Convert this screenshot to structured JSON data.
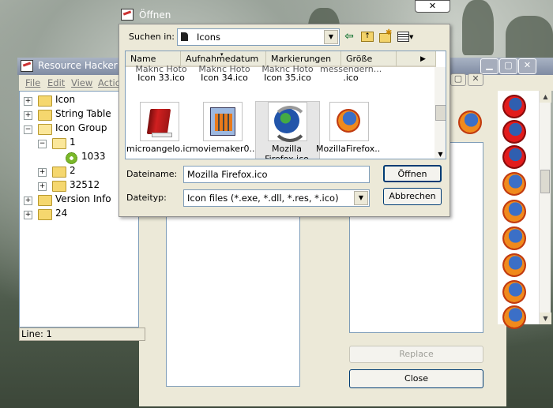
{
  "resource_hacker": {
    "title": "Resource Hacker - G",
    "menu": [
      "File",
      "Edit",
      "View",
      "Actio"
    ],
    "tree": [
      {
        "label": "Icon",
        "level": 0,
        "expander": "+"
      },
      {
        "label": "String Table",
        "level": 0,
        "expander": "+"
      },
      {
        "label": "Icon Group",
        "level": 0,
        "expander": "-"
      },
      {
        "label": "1",
        "level": 1,
        "expander": "-"
      },
      {
        "label": "1033",
        "level": 2,
        "expander": ""
      },
      {
        "label": "2",
        "level": 1,
        "expander": "+"
      },
      {
        "label": "32512",
        "level": 1,
        "expander": "+"
      },
      {
        "label": "Version Info",
        "level": 0,
        "expander": "+"
      },
      {
        "label": "24",
        "level": 0,
        "expander": "+"
      }
    ],
    "status": "Line: 1",
    "replace_button": "Replace",
    "close_button": "Close"
  },
  "dialog": {
    "title": "Öffnen",
    "look_in_label": "Suchen in:",
    "look_in_value": "Icons",
    "columns": [
      "Name",
      "Aufnahmedatum",
      "Markierungen",
      "Größe"
    ],
    "cut_row": [
      "Icon 33.ico",
      "Icon 34.ico",
      "Icon 35.ico",
      ".ico"
    ],
    "cut_row_top": [
      "Maknc Hoto",
      "Maknc Hoto",
      "Maknc Hoto",
      "messengern..."
    ],
    "files": [
      {
        "label": "microangelo.ico",
        "icon": "red-book-icon"
      },
      {
        "label": "moviemaker0...",
        "icon": "film-icon"
      },
      {
        "label": "Mozilla Firefox.ico",
        "icon": "mozilla-globe-icon",
        "selected": true
      },
      {
        "label": "MozillaFirefox...",
        "icon": "firefox-icon"
      }
    ],
    "filename_label": "Dateiname:",
    "filename_value": "Mozilla Firefox.ico",
    "filetype_label": "Dateityp:",
    "filetype_value": "Icon files (*.exe, *.dll, *.res, *.ico)",
    "open_button": "Öffnen",
    "cancel_button": "Abbrechen"
  },
  "colors": {
    "accent": "#003c74",
    "selection": "#e6e6e6",
    "firefox_orange": "#f08a1c"
  }
}
